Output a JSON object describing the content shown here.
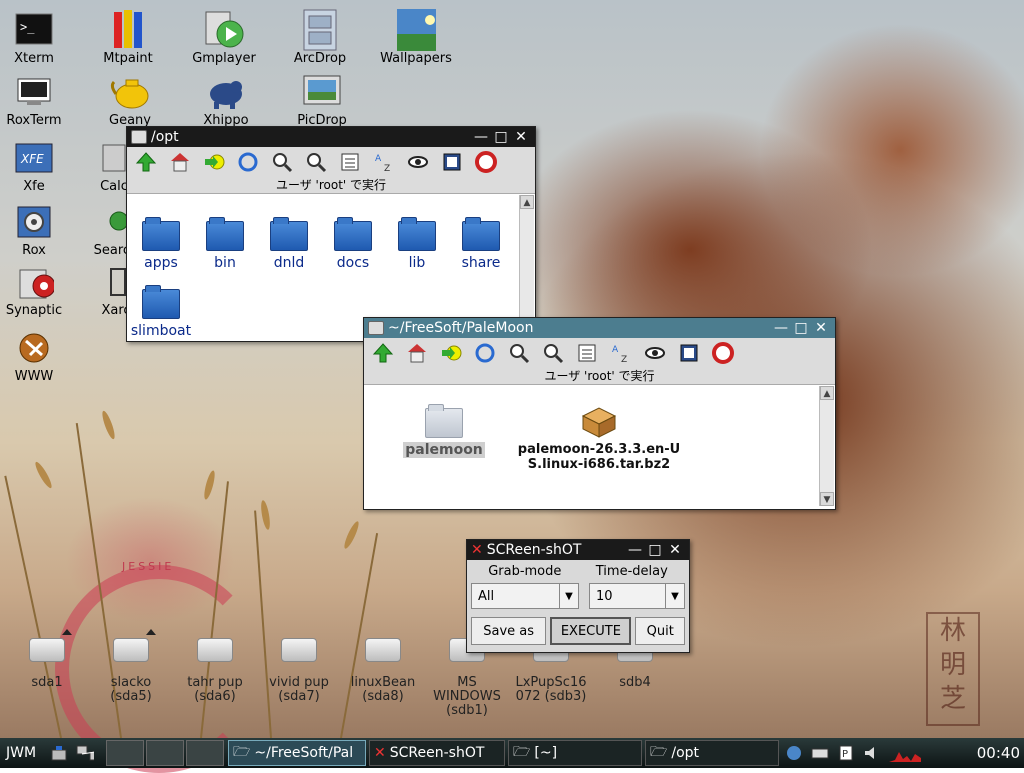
{
  "desktop": {
    "icons": [
      {
        "label": "Xterm",
        "icon": "terminal-icon"
      },
      {
        "label": "Mtpaint",
        "icon": "pencils-icon"
      },
      {
        "label": "Gmplayer",
        "icon": "media-player-icon"
      },
      {
        "label": "ArcDrop",
        "icon": "archive-icon"
      },
      {
        "label": "Wallpapers",
        "icon": "wallpaper-icon"
      },
      {
        "label": "RoxTerm",
        "icon": "terminal-icon"
      },
      {
        "label": "Geany",
        "icon": "teapot-icon"
      },
      {
        "label": "Xhippo",
        "icon": "hippo-icon"
      },
      {
        "label": "PicDrop",
        "icon": "picture-icon"
      },
      {
        "label": "Xfe",
        "icon": "xfe-icon"
      },
      {
        "label": "Calc",
        "icon": "calculator-icon"
      },
      {
        "label": "Rox",
        "icon": "gear-icon"
      },
      {
        "label": "Search",
        "icon": "search-icon"
      },
      {
        "label": "Synaptic",
        "icon": "package-icon"
      },
      {
        "label": "Xarc",
        "icon": "archive-icon"
      },
      {
        "label": "WWW",
        "icon": "globe-icon"
      }
    ],
    "wallpaper_text": "JESSIE",
    "seal_text": "林 明 芝",
    "drives": [
      {
        "label": "sda1"
      },
      {
        "label": "slacko\n(sda5)"
      },
      {
        "label": "tahr pup\n(sda6)"
      },
      {
        "label": "vivid pup\n(sda7)"
      },
      {
        "label": "linuxBean\n(sda8)"
      },
      {
        "label": "MS\nWINDOWS\n(sdb1)"
      },
      {
        "label": "LxPupSc16\n072 (sdb3)"
      },
      {
        "label": "sdb4"
      }
    ]
  },
  "win_opt": {
    "title": "/opt",
    "root_text": "ユーザ 'root' で実行",
    "items": [
      "apps",
      "bin",
      "dnld",
      "docs",
      "lib",
      "share",
      "slimboat"
    ]
  },
  "win_palemoon": {
    "title": "~/FreeSoft/PaleMoon",
    "root_text": "ユーザ 'root' で実行",
    "items": [
      "palemoon",
      "palemoon-26.3.3.en-US.linux-i686.tar.bz2"
    ]
  },
  "screenshot": {
    "title": "SCReen-shOT",
    "grab_mode_label": "Grab-mode",
    "time_delay_label": "Time-delay",
    "grab_mode_value": "All",
    "time_delay_value": "10",
    "save_as": "Save as",
    "execute": "EXECUTE",
    "quit": "Quit"
  },
  "taskbar": {
    "menu_label": "JWM",
    "tasks": [
      "~/FreeSoft/Pal",
      "SCReen-shOT",
      "[~]",
      "/opt"
    ],
    "clock": "00:40"
  }
}
